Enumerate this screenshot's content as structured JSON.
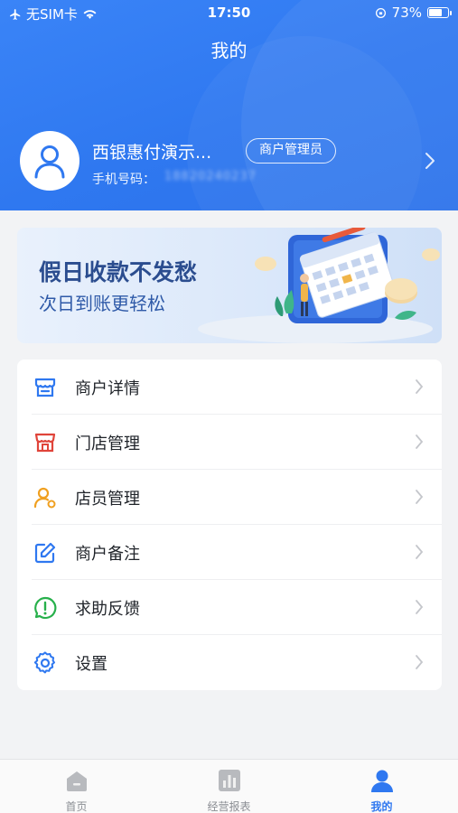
{
  "status_bar": {
    "carrier": "无SIM卡",
    "time": "17:50",
    "battery": "73%",
    "battery_level": 0.73
  },
  "header": {
    "title": "我的"
  },
  "profile": {
    "name": "西银惠付演示...",
    "role_badge": "商户管理员",
    "phone_label": "手机号码：",
    "phone_value": "18820240237"
  },
  "banner": {
    "title": "假日收款不发愁",
    "subtitle": "次日到账更轻松"
  },
  "menu": {
    "items": [
      {
        "label": "商户详情",
        "icon": "store-icon",
        "color": "#2f78f0"
      },
      {
        "label": "门店管理",
        "icon": "shop-icon",
        "color": "#e0443a"
      },
      {
        "label": "店员管理",
        "icon": "staff-icon",
        "color": "#f0a020"
      },
      {
        "label": "商户备注",
        "icon": "edit-icon",
        "color": "#2f78f0"
      },
      {
        "label": "求助反馈",
        "icon": "help-icon",
        "color": "#27b04b"
      },
      {
        "label": "设置",
        "icon": "gear-icon",
        "color": "#2f78f0"
      }
    ]
  },
  "tabbar": {
    "tabs": [
      {
        "label": "首页",
        "icon": "home-icon"
      },
      {
        "label": "经营报表",
        "icon": "report-icon"
      },
      {
        "label": "我的",
        "icon": "user-icon",
        "active": true
      }
    ]
  },
  "colors": {
    "primary": "#2f78f0",
    "background": "#f2f3f5"
  }
}
